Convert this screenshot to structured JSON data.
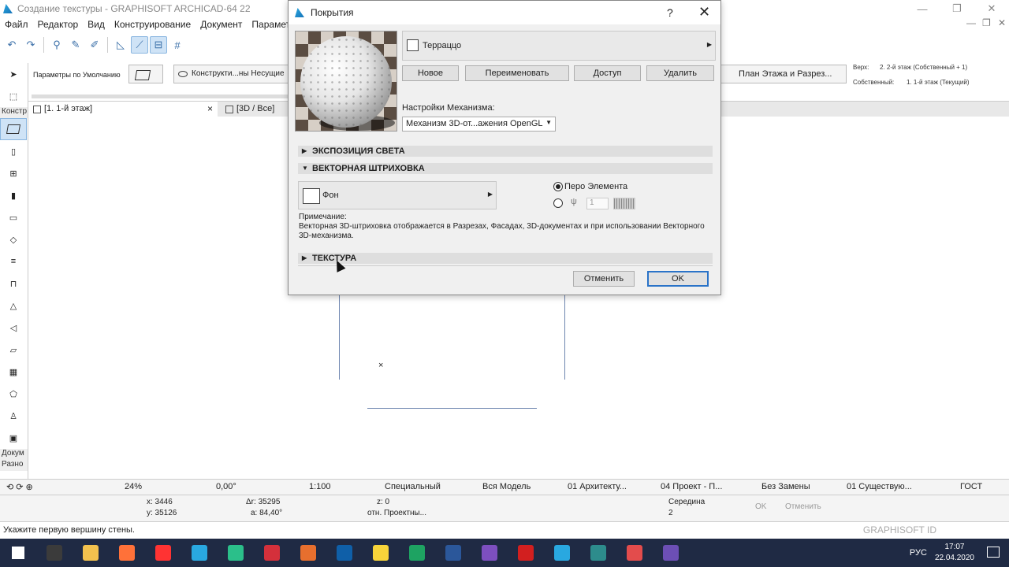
{
  "window": {
    "title": "Создание текстуры - GRAPHISOFT ARCHICAD-64 22",
    "controls": [
      "—",
      "❐",
      "✕"
    ]
  },
  "menu": [
    "Файл",
    "Редактор",
    "Вид",
    "Конструирование",
    "Документ",
    "Параметры"
  ],
  "menu_right_controls": [
    "—",
    "❐",
    "✕"
  ],
  "infobox": {
    "default_params": "Параметры по Умолчанию",
    "layer": "Конструкти...ны Несущие",
    "plan": "План Этажа и Разрез...",
    "top_label": "Верх:",
    "top_value": "2. 2-й этаж (Собственный + 1)",
    "own_label": "Собственный:",
    "own_value": "1. 1-й этаж (Текущий)"
  },
  "tabs": {
    "floor": "[1. 1-й этаж]",
    "floor_close": "×",
    "view3d": "[3D / Все]"
  },
  "left_toolbox": {
    "design_label": "Констр",
    "document_label": "Докум",
    "misc_label": "Разно"
  },
  "bottom_bar": {
    "zoom": "24%",
    "angle": "0,00°",
    "scale": "1:100",
    "display": "Специальный",
    "model": "Вся Модель",
    "pen": "01 Архитекту...",
    "plan_type": "04 Проект - П...",
    "override": "Без Замены",
    "renovation": "01 Существую...",
    "standard": "ГОСТ"
  },
  "coords": {
    "x": "x: 3446",
    "y": "y: 35126",
    "dr": "Δr: 35295",
    "angle": "a: 84,40°",
    "z": "z: 0",
    "ref": "отн. Проектны...",
    "snap": "Середина",
    "snap_num": "2",
    "ok": "OK",
    "cancel": "Отменить"
  },
  "status": {
    "hint": "Укажите первую вершину стены.",
    "brand": "GRAPHISOFT ID"
  },
  "taskbar": {
    "lang": "РУС",
    "time": "17:07",
    "date": "22.04.2020",
    "apps": [
      {
        "name": "windows-start",
        "color": "#ffffff"
      },
      {
        "name": "calculator",
        "color": "#3b3b3b"
      },
      {
        "name": "file-explorer",
        "color": "#f2c14e"
      },
      {
        "name": "firefox",
        "color": "#ff7139"
      },
      {
        "name": "yandex",
        "color": "#ff3333"
      },
      {
        "name": "archicad",
        "color": "#29a8e0"
      },
      {
        "name": "app-3",
        "color": "#2bbf8a"
      },
      {
        "name": "autocad",
        "color": "#d4303b"
      },
      {
        "name": "app-eye",
        "color": "#e76f2e"
      },
      {
        "name": "photoshop",
        "color": "#0f5fa8"
      },
      {
        "name": "sticky-notes",
        "color": "#f7d43a"
      },
      {
        "name": "app-green",
        "color": "#1ea362"
      },
      {
        "name": "word",
        "color": "#2b579a"
      },
      {
        "name": "viber",
        "color": "#7d4fbf"
      },
      {
        "name": "acrobat",
        "color": "#d21f1f"
      },
      {
        "name": "archicad-2",
        "color": "#29a8e0"
      },
      {
        "name": "app-monitor",
        "color": "#2d8c8c"
      },
      {
        "name": "app-chart",
        "color": "#e34c4c"
      },
      {
        "name": "visual-studio",
        "color": "#6c4fb5"
      }
    ]
  },
  "dialog": {
    "title": "Покрытия",
    "help": "?",
    "close": "✕",
    "surface_name": "Терраццо",
    "buttons": {
      "new": "Новое",
      "rename": "Переименовать",
      "access": "Доступ",
      "delete": "Удалить"
    },
    "engine_label": "Настройки Механизма:",
    "engine_value": "Механизм 3D-от...ажения OpenGL",
    "sections": {
      "exposure": "ЭКСПОЗИЦИЯ СВЕТА",
      "vector_hatch": "ВЕКТОРНАЯ ШТРИХОВКА",
      "texture": "ТЕКСТУРА"
    },
    "background": "Фон",
    "pen_element": "Перо Элемента",
    "pen_number": "1",
    "note_label": "Примечание:",
    "note_text": "Векторная 3D-штриховка отображается в Разрезах, Фасадах, 3D-документах и при использовании Векторного 3D-механизма.",
    "cancel": "Отменить",
    "ok": "OK"
  }
}
